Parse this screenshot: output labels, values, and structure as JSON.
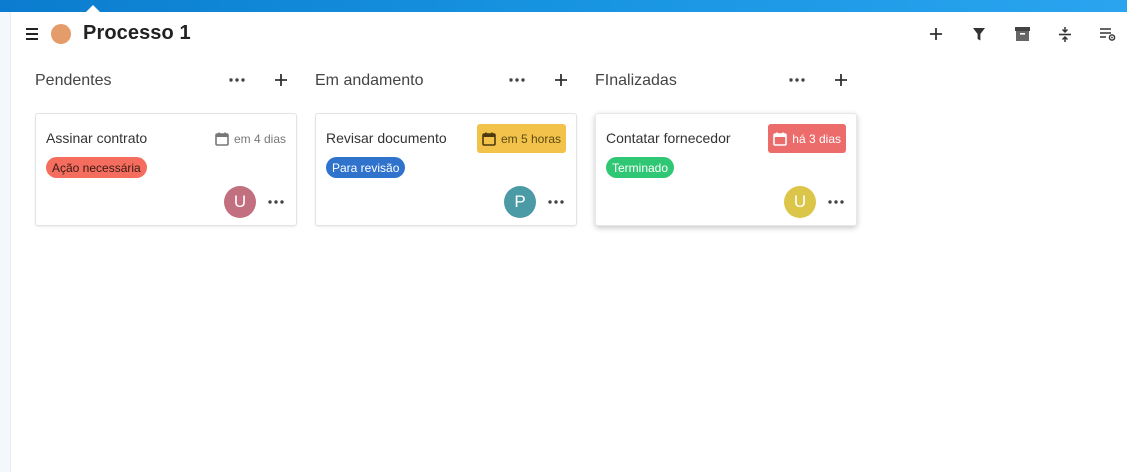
{
  "header": {
    "title": "Processo 1",
    "process_color": "#e49c6a",
    "toolbar_icons": [
      "add-icon",
      "filter-icon",
      "archive-icon",
      "collapse-icon",
      "list-settings-icon"
    ]
  },
  "columns": [
    {
      "title": "Pendentes",
      "cards": [
        {
          "title": "Assinar contrato",
          "due": "em 4 dias",
          "due_status": "plain",
          "tag": "Ação necessária",
          "tag_color": "#f46d5e",
          "tag_text_color": "#3a1a15",
          "avatar_initial": "U",
          "avatar_color": "#c2707f"
        }
      ]
    },
    {
      "title": "Em andamento",
      "cards": [
        {
          "title": "Revisar documento",
          "due": "em 5 horas",
          "due_status": "warn",
          "tag": "Para revisão",
          "tag_color": "#2f73cc",
          "tag_text_color": "#ffffff",
          "avatar_initial": "P",
          "avatar_color": "#4b9ba6"
        }
      ]
    },
    {
      "title": "FInalizadas",
      "cards": [
        {
          "title": "Contatar fornecedor",
          "due": "há 3 dias",
          "due_status": "danger",
          "tag": "Terminado",
          "tag_color": "#30c774",
          "tag_text_color": "#ffffff",
          "avatar_initial": "U",
          "avatar_color": "#dcc64a"
        }
      ]
    }
  ]
}
